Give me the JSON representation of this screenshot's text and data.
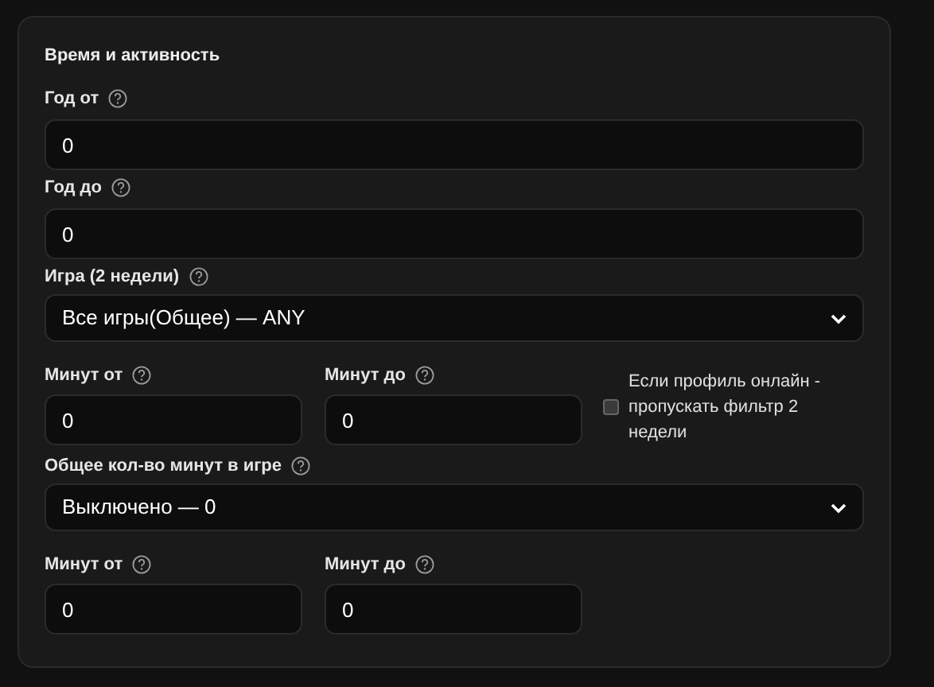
{
  "panel": {
    "title": "Время и активность"
  },
  "rows": [
    {
      "kind": "input",
      "label": "Год от",
      "value": "0"
    },
    {
      "kind": "input",
      "label": "Год до",
      "value": "0"
    },
    {
      "kind": "select",
      "label": "Игра (2 недели)",
      "value": "Все игры(Общее) — ANY"
    },
    {
      "kind": "pair",
      "fields": [
        {
          "label": "Минут от",
          "value": "0"
        },
        {
          "label": "Минут до",
          "value": "0"
        }
      ],
      "checkbox": {
        "label": "Если профиль онлайн - пропускать фильтр 2 недели",
        "checked": false
      }
    },
    {
      "kind": "select",
      "label": "Общее кол-во минут в игре",
      "value": "Выключено — 0"
    },
    {
      "kind": "pair",
      "fields": [
        {
          "label": "Минут от",
          "value": "0"
        },
        {
          "label": "Минут до",
          "value": "0"
        }
      ]
    }
  ]
}
